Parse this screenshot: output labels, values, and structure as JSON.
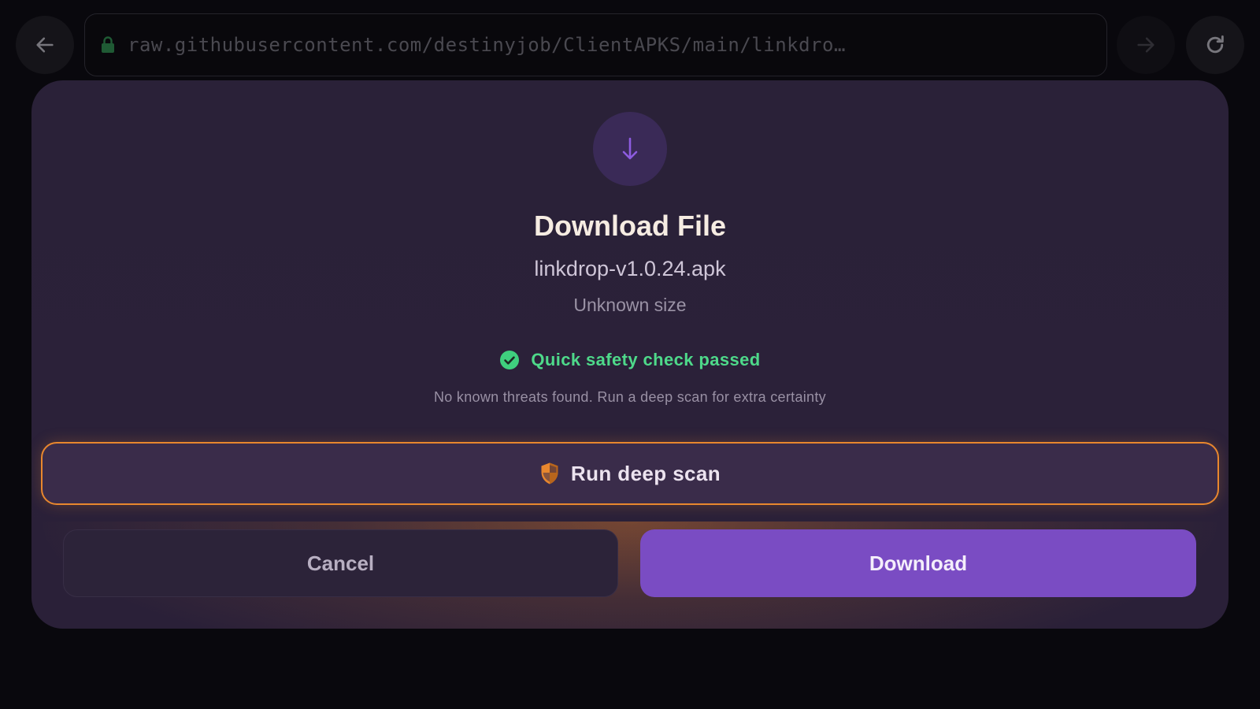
{
  "browser": {
    "url": "raw.githubusercontent.com/destinyjob/ClientAPKS/main/linkdro…",
    "icons": {
      "back": "arrow-left-icon",
      "forward": "arrow-right-icon",
      "reload": "reload-icon",
      "lock": "lock-icon"
    }
  },
  "dialog": {
    "icon": "download-arrow-icon",
    "title": "Download File",
    "filename": "linkdrop-v1.0.24.apk",
    "size": "Unknown size",
    "safety": {
      "icon": "check-circle-icon",
      "status": "Quick safety check passed",
      "detail": "No known threats found. Run a deep scan for extra certainty"
    },
    "deep_scan": {
      "icon": "shield-icon",
      "label": "Run deep scan"
    },
    "cancel_label": "Cancel",
    "download_label": "Download"
  },
  "colors": {
    "accent": "#7a4cc3",
    "safe": "#4ed98a",
    "warning_border": "#e8872e",
    "dialog_bg": "#2a2138",
    "page_bg": "#09080d"
  }
}
